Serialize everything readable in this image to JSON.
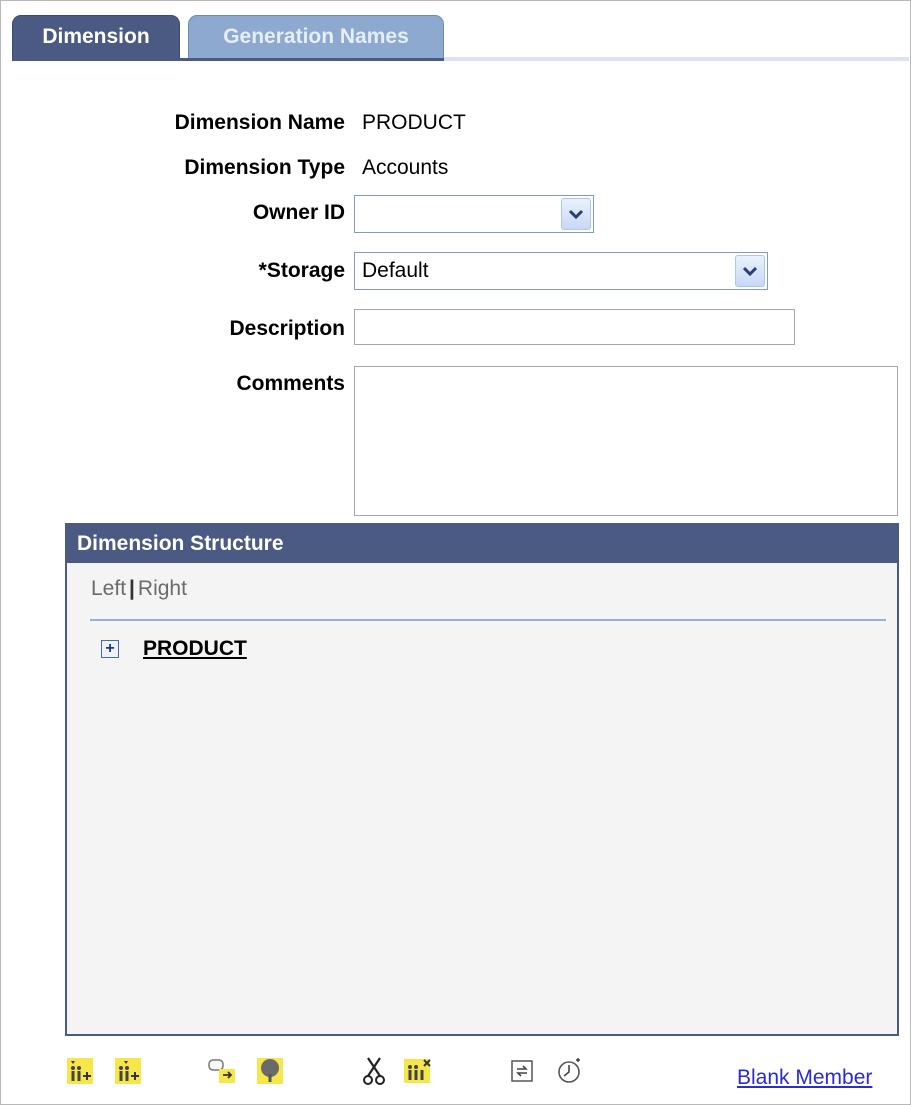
{
  "tabs": {
    "active_label": "Dimension",
    "inactive_label": "Generation Names"
  },
  "form": {
    "dimension_name_label": "Dimension Name",
    "dimension_name_value": "PRODUCT",
    "dimension_type_label": "Dimension Type",
    "dimension_type_value": "Accounts",
    "owner_id_label": "Owner ID",
    "owner_id_value": "",
    "storage_label": "*Storage",
    "storage_value": "Default",
    "description_label": "Description",
    "description_value": "",
    "comments_label": "Comments",
    "comments_value": ""
  },
  "structure": {
    "title": "Dimension Structure",
    "left_label": "Left",
    "separator": "|",
    "right_label": "Right",
    "root_node": "PRODUCT"
  },
  "toolbar": {
    "icons": [
      "insert-child-icon",
      "insert-sibling-icon",
      "move-member-icon",
      "tree-icon",
      "cut-icon",
      "delete-member-icon",
      "refresh-icon",
      "history-icon"
    ],
    "blank_member_label": "Blank Member"
  },
  "colors": {
    "header_bg": "#4a5a82",
    "tab_inactive": "#8ea9d0",
    "link": "#2a2ad6",
    "icon_yellow": "#f5e64a"
  }
}
